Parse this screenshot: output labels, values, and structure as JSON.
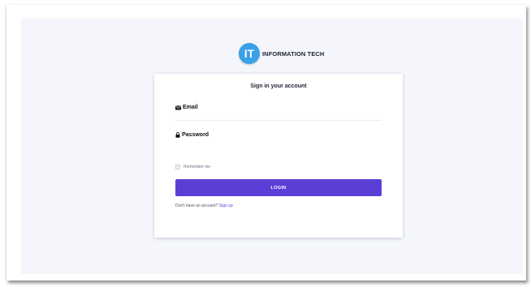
{
  "brand": {
    "logo_text": "IT",
    "name": "INFORMATION TECH",
    "logo_color": "#3aa0e8"
  },
  "form": {
    "title": "Sign in your account",
    "email_label": "Email",
    "email_icon": "envelope-icon",
    "email_value": "",
    "password_label": "Password",
    "password_icon": "lock-icon",
    "password_value": "",
    "remember_label": "Remember me",
    "login_label": "LOGIN",
    "signup_prompt": "Don't have an account?",
    "signup_link": "Sign up"
  },
  "colors": {
    "accent": "#5b3ed6",
    "background": "#f4f6fb"
  }
}
